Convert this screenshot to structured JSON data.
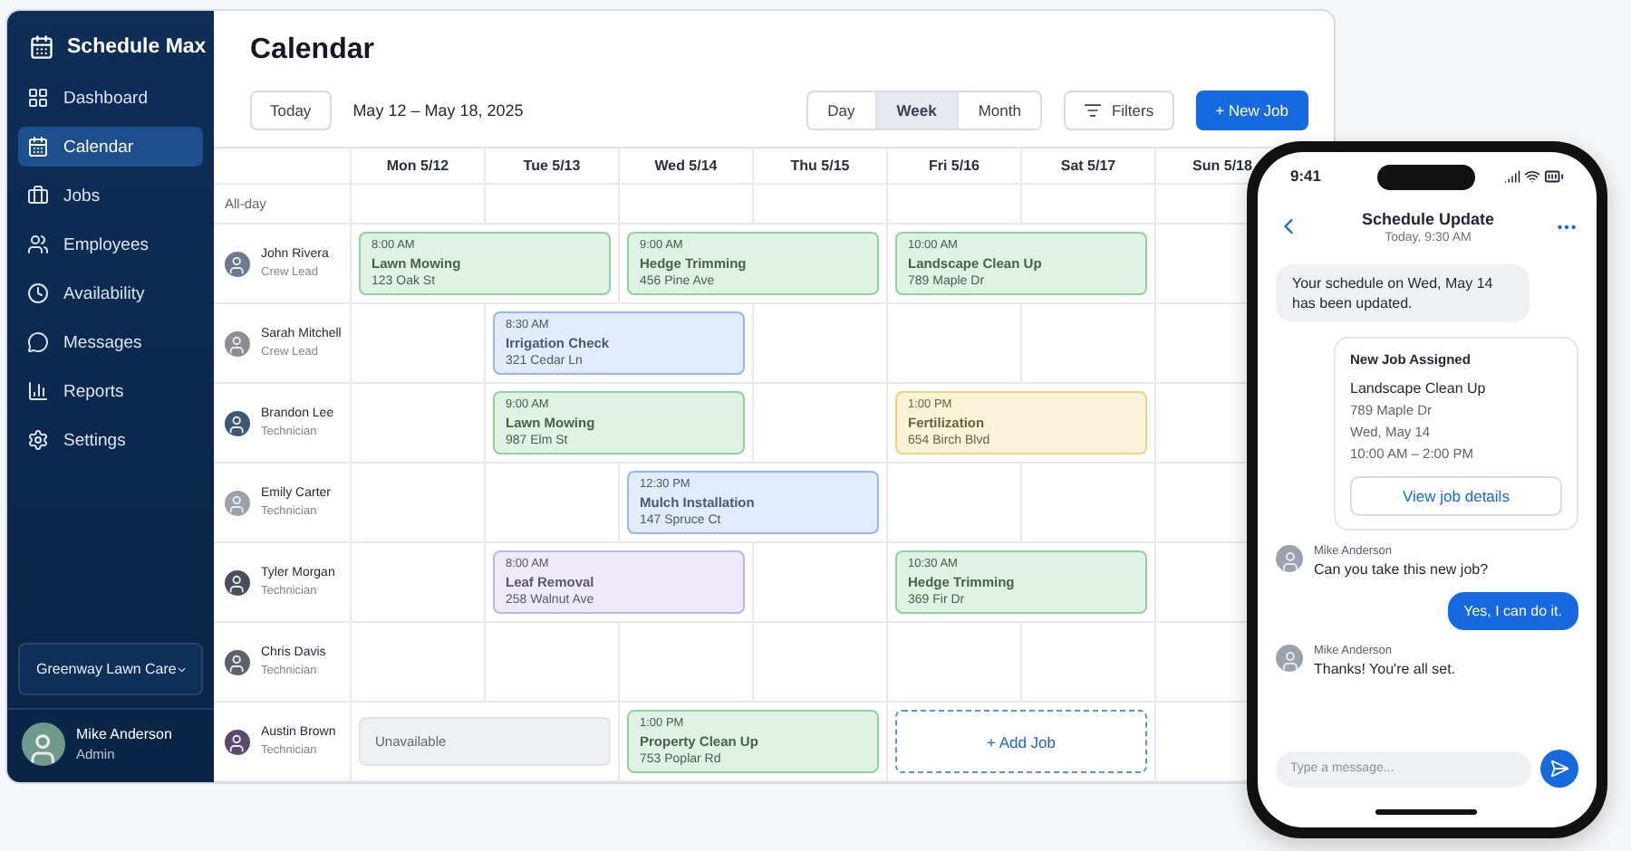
{
  "app": {
    "name": "Schedule Max"
  },
  "sidebar": {
    "items": [
      {
        "label": "Dashboard",
        "selected": false
      },
      {
        "label": "Calendar",
        "selected": true
      },
      {
        "label": "Jobs",
        "selected": false
      },
      {
        "label": "Employees",
        "selected": false
      },
      {
        "label": "Availability",
        "selected": false
      },
      {
        "label": "Messages",
        "selected": false
      },
      {
        "label": "Reports",
        "selected": false
      },
      {
        "label": "Settings",
        "selected": false
      }
    ],
    "workspace": "Greenway Lawn Care",
    "user": {
      "name": "Mike Anderson",
      "role": "Admin"
    }
  },
  "header": {
    "title": "Calendar",
    "today": "Today",
    "range": "May 12 – May 18, 2025",
    "views": [
      {
        "label": "Day",
        "selected": false
      },
      {
        "label": "Week",
        "selected": true
      },
      {
        "label": "Month",
        "selected": false
      }
    ],
    "filters": "Filters",
    "new_job": "+ New Job"
  },
  "calendar": {
    "days": [
      "Mon 5/12",
      "Tue 5/13",
      "Wed 5/14",
      "Thu 5/15",
      "Fri 5/16",
      "Sat 5/17",
      "Sun 5/18"
    ],
    "all_day": "All-day",
    "rows": [
      {
        "name": "John Rivera",
        "role": "Crew Lead",
        "slots": [
          {
            "kind": "job",
            "wide": true,
            "time": "8:00 AM",
            "title": "Lawn Mowing",
            "address": "123 Oak St",
            "color": "#8fd19e"
          },
          {
            "kind": "job",
            "wide": true,
            "time": "9:00 AM",
            "title": "Hedge Trimming",
            "address": "456 Pine Ave",
            "color": "#8fd19e"
          },
          {
            "kind": "job",
            "wide": true,
            "time": "10:00 AM",
            "title": "Landscape Clean Up",
            "address": "789 Maple Dr",
            "color": "#8fd19e"
          },
          {
            "kind": "empty"
          }
        ]
      },
      {
        "name": "Sarah Mitchell",
        "role": "Crew Lead",
        "slots": [
          {
            "kind": "empty"
          },
          {
            "kind": "job",
            "wide": true,
            "time": "8:30 AM",
            "title": "Irrigation Check",
            "address": "321 Cedar Ln",
            "color": "#93b8f0"
          },
          {
            "kind": "empty"
          },
          {
            "kind": "empty"
          },
          {
            "kind": "empty"
          },
          {
            "kind": "empty"
          }
        ]
      },
      {
        "name": "Brandon Lee",
        "role": "Technician",
        "slots": [
          {
            "kind": "empty"
          },
          {
            "kind": "job",
            "wide": true,
            "time": "9:00 AM",
            "title": "Lawn Mowing",
            "address": "987 Elm St",
            "color": "#8fd19e"
          },
          {
            "kind": "empty"
          },
          {
            "kind": "job",
            "wide": true,
            "time": "1:00 PM",
            "title": "Fertilization",
            "address": "654 Birch Blvd",
            "color": "#f2d27a"
          },
          {
            "kind": "empty"
          }
        ]
      },
      {
        "name": "Emily Carter",
        "role": "Technician",
        "slots": [
          {
            "kind": "empty"
          },
          {
            "kind": "empty"
          },
          {
            "kind": "job",
            "wide": true,
            "time": "12:30 PM",
            "title": "Mulch Installation",
            "address": "147 Spruce Ct",
            "color": "#93b8f0"
          },
          {
            "kind": "empty"
          },
          {
            "kind": "empty"
          },
          {
            "kind": "empty"
          }
        ]
      },
      {
        "name": "Tyler Morgan",
        "role": "Technician",
        "slots": [
          {
            "kind": "empty"
          },
          {
            "kind": "job",
            "wide": true,
            "time": "8:00 AM",
            "title": "Leaf Removal",
            "address": "258 Walnut Ave",
            "color": "#c5b0ee"
          },
          {
            "kind": "empty"
          },
          {
            "kind": "job",
            "wide": true,
            "time": "10:30 AM",
            "title": "Hedge Trimming",
            "address": "369 Fir Dr",
            "color": "#8fd19e"
          },
          {
            "kind": "empty"
          }
        ]
      },
      {
        "name": "Chris Davis",
        "role": "Technician",
        "slots": [
          {
            "kind": "empty"
          },
          {
            "kind": "empty"
          },
          {
            "kind": "empty"
          },
          {
            "kind": "empty"
          },
          {
            "kind": "empty"
          },
          {
            "kind": "empty"
          },
          {
            "kind": "empty"
          }
        ]
      },
      {
        "name": "Austin Brown",
        "role": "Technician",
        "slots": [
          {
            "kind": "unavailable",
            "wide": true,
            "text": "Unavailable"
          },
          {
            "kind": "job",
            "wide": true,
            "time": "1:00 PM",
            "title": "Property Clean Up",
            "address": "753 Poplar Rd",
            "color": "#8fd19e"
          },
          {
            "kind": "add",
            "wide": true,
            "text": "+ Add Job"
          },
          {
            "kind": "empty"
          }
        ]
      }
    ]
  },
  "phone": {
    "time": "9:41",
    "chat": {
      "title": "Schedule Update",
      "subtitle": "Today, 9:30 AM"
    },
    "messages": [
      {
        "kind": "system",
        "text": "Your schedule on Wed, May 14 has been updated."
      },
      {
        "kind": "card",
        "heading": "New Job Assigned",
        "job": "Landscape Clean Up",
        "address": "789 Maple Dr",
        "date": "Wed, May 14",
        "hours": "10:00 AM – 2:00 PM",
        "button": "View job details"
      },
      {
        "kind": "received",
        "sender": "Mike Anderson",
        "text": "Can you take this new job?"
      },
      {
        "kind": "sent",
        "text": "Yes, I can do it."
      },
      {
        "kind": "received",
        "sender": "Mike Anderson",
        "text": "Thanks! You're all set."
      }
    ],
    "composer": {
      "placeholder": "Type a message..."
    }
  }
}
